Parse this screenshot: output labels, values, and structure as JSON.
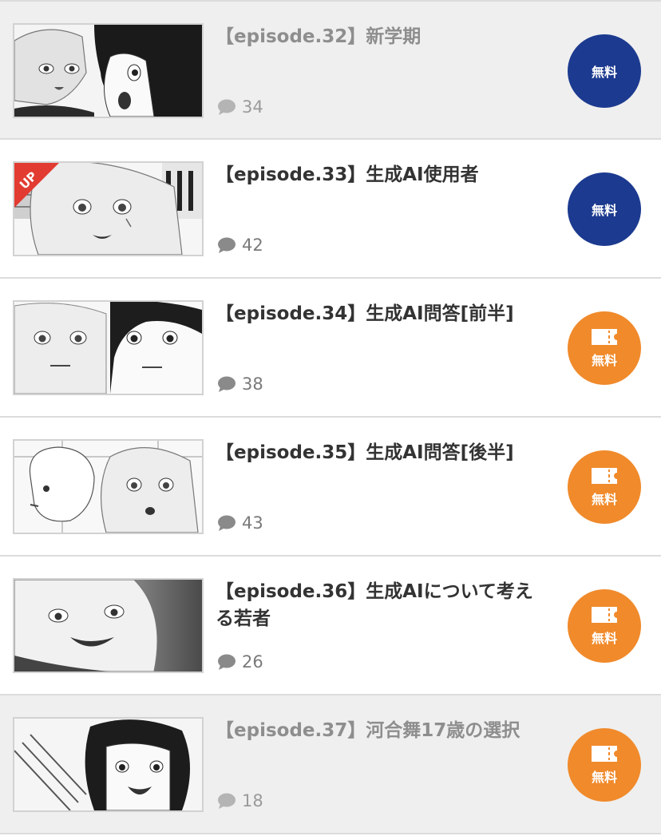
{
  "episodes": [
    {
      "title": "【episode.32】新学期",
      "comments": "34",
      "badge_label": "無料",
      "badge_type": "free",
      "read": true,
      "up": false
    },
    {
      "title": "【episode.33】生成AI使用者",
      "comments": "42",
      "badge_label": "無料",
      "badge_type": "free",
      "read": false,
      "up": true,
      "up_label": "UP"
    },
    {
      "title": "【episode.34】生成AI問答[前半]",
      "comments": "38",
      "badge_label": "無料",
      "badge_type": "ticket",
      "read": false,
      "up": false
    },
    {
      "title": "【episode.35】生成AI問答[後半]",
      "comments": "43",
      "badge_label": "無料",
      "badge_type": "ticket",
      "read": false,
      "up": false
    },
    {
      "title": "【episode.36】生成AIについて考える若者",
      "comments": "26",
      "badge_label": "無料",
      "badge_type": "ticket",
      "read": false,
      "up": false
    },
    {
      "title": "【episode.37】河合舞17歳の選択",
      "comments": "18",
      "badge_label": "無料",
      "badge_type": "ticket",
      "read": true,
      "up": false
    }
  ],
  "colors": {
    "free_badge": "#1c3a8f",
    "ticket_badge": "#f08a2b",
    "up_ribbon": "#e23b32",
    "read_row_bg": "#efefef"
  },
  "icons": {
    "comment": "speech-bubble-icon",
    "ticket": "ticket-icon"
  }
}
